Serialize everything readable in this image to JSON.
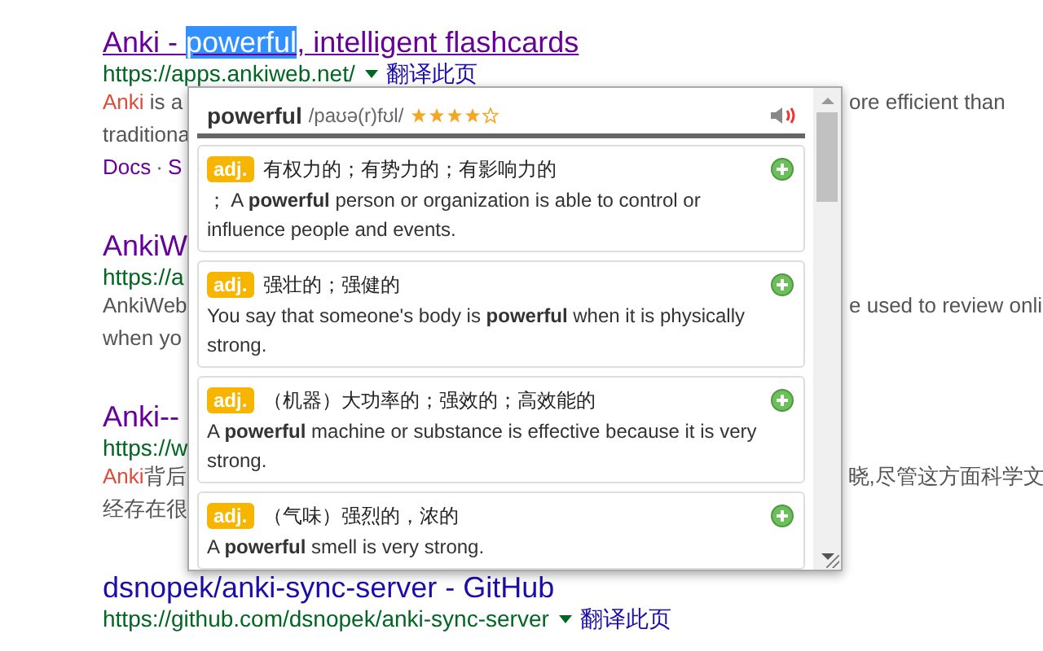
{
  "results": [
    {
      "title_parts": [
        {
          "text": "Anki - "
        },
        {
          "text": "powerful",
          "selected": true
        },
        {
          "text": ", intelligent flashcards"
        }
      ],
      "visited": true,
      "url": "https://apps.ankiweb.net/",
      "translate": "翻译此页",
      "snippet": [
        {
          "left": "**Anki** is a",
          "right": "ore efficient than"
        },
        {
          "left": "traditiona"
        },
        {
          "links": [
            "Docs",
            "S"
          ],
          "separator": "·"
        }
      ]
    },
    {
      "title_parts": [
        {
          "text": "AnkiW"
        }
      ],
      "visited": true,
      "url": "https://a",
      "snippet": [
        {
          "left": "AnkiWeb",
          "right": "e used to review onli"
        },
        {
          "left": "when yo"
        }
      ]
    },
    {
      "title_parts": [
        {
          "text": "Anki--"
        }
      ],
      "visited": true,
      "url": "https://w",
      "snippet": [
        {
          "left": "**Anki**背后",
          "right": "晓,尽管这方面科学文"
        },
        {
          "left": "经存在很"
        }
      ]
    },
    {
      "title_parts": [
        {
          "text": "dsnopek/anki-sync-server - GitHub"
        }
      ],
      "visited": false,
      "url": "https://github.com/dsnopek/anki-sync-server",
      "translate": "翻译此页"
    }
  ],
  "popup": {
    "word": "powerful",
    "phonetic": "/paʊə(r)fʊl/",
    "stars": 4,
    "entries": [
      {
        "pos": "adj.",
        "meaning": "有权力的；有势力的；有影响力的",
        "definition": "； A **powerful** person or organization is able to control or influence people and events."
      },
      {
        "pos": "adj.",
        "meaning": "强壮的；强健的",
        "definition": "You say that someone's body is **powerful** when it is physically strong."
      },
      {
        "pos": "adj.",
        "meaning": "（机器）大功率的；强效的；高效能的",
        "definition": "A **powerful** machine or substance is effective because it is very strong."
      },
      {
        "pos": "adj.",
        "meaning": "（气味）强烈的，浓的",
        "definition": "A **powerful** smell is very strong."
      }
    ]
  }
}
